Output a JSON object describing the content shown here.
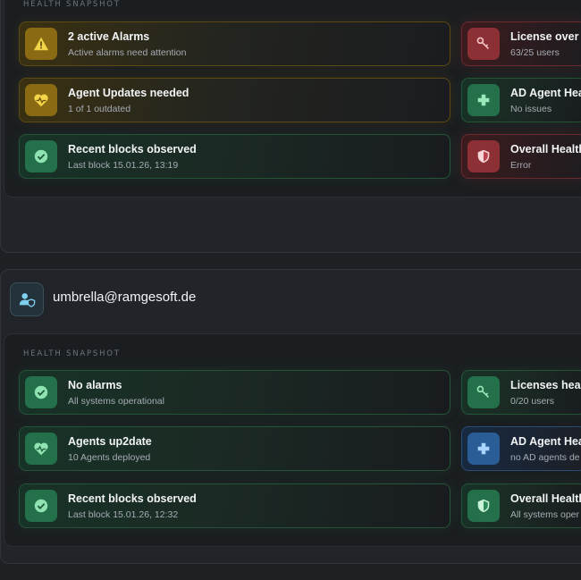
{
  "top_account": {
    "snapshot_title": "HEALTH SNAPSHOT",
    "cards_left": [
      {
        "status": "warning",
        "icon": "warning-triangle-icon",
        "title": "2 active Alarms",
        "subtitle": "Active alarms need attention"
      },
      {
        "status": "warning",
        "icon": "heartbeat-icon",
        "title": "Agent Updates needed",
        "subtitle": "1 of 1 outdated"
      },
      {
        "status": "ok",
        "icon": "check-circle-icon",
        "title": "Recent blocks observed",
        "subtitle": "Last block 15.01.26, 13:19"
      }
    ],
    "cards_right": [
      {
        "status": "error",
        "icon": "license-key-icon",
        "title": "License over c",
        "subtitle": "63/25 users"
      },
      {
        "status": "ok",
        "icon": "medical-cross-icon",
        "title": "AD Agent Hea",
        "subtitle": "No issues"
      },
      {
        "status": "error",
        "icon": "shield-icon",
        "title": "Overall Health",
        "subtitle": "Error"
      }
    ]
  },
  "bottom_account": {
    "account_name": "umbrella@ramgesoft.de",
    "snapshot_title": "HEALTH SNAPSHOT",
    "cards_left": [
      {
        "status": "ok",
        "icon": "check-circle-icon",
        "title": "No alarms",
        "subtitle": "All systems operational"
      },
      {
        "status": "ok",
        "icon": "heartbeat-icon",
        "title": "Agents up2date",
        "subtitle": "10 Agents deployed"
      },
      {
        "status": "ok",
        "icon": "check-circle-icon",
        "title": "Recent blocks observed",
        "subtitle": "Last block 15.01.26, 12:32"
      }
    ],
    "cards_right": [
      {
        "status": "ok",
        "icon": "license-key-icon",
        "title": "Licenses healt",
        "subtitle": "0/20 users"
      },
      {
        "status": "info",
        "icon": "medical-cross-icon",
        "title": "AD Agent Hea",
        "subtitle": "no AD agents de"
      },
      {
        "status": "ok",
        "icon": "shield-icon",
        "title": "Overall Health",
        "subtitle": "All systems oper"
      }
    ]
  },
  "colors": {
    "warning": "#8a6a12",
    "ok": "#23704a",
    "error": "#8c3036",
    "info": "#2a5c96"
  }
}
